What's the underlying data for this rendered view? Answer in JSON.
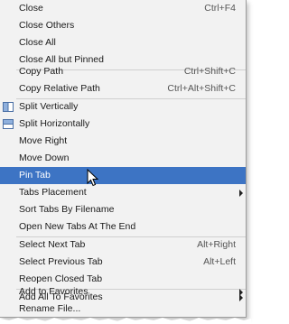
{
  "menu": {
    "items": [
      {
        "label": "Close",
        "shortcut": "Ctrl+F4"
      },
      {
        "label": "Close Others",
        "shortcut": ""
      },
      {
        "label": "Close All",
        "shortcut": ""
      },
      {
        "label": "Close All but Pinned",
        "shortcut": ""
      },
      {
        "label": "Copy Path",
        "shortcut": "Ctrl+Shift+C"
      },
      {
        "label": "Copy Relative Path",
        "shortcut": "Ctrl+Alt+Shift+C"
      },
      {
        "label": "Split Vertically",
        "shortcut": "",
        "icon": "split-vertical-icon"
      },
      {
        "label": "Split Horizontally",
        "shortcut": "",
        "icon": "split-horizontal-icon"
      },
      {
        "label": "Move Right",
        "shortcut": ""
      },
      {
        "label": "Move Down",
        "shortcut": ""
      },
      {
        "label": "Pin Tab",
        "shortcut": "",
        "selected": true
      },
      {
        "label": "Tabs Placement",
        "shortcut": "",
        "submenu": true
      },
      {
        "label": "Sort Tabs By Filename",
        "shortcut": ""
      },
      {
        "label": "Open New Tabs At The End",
        "shortcut": ""
      },
      {
        "label": "Select Next Tab",
        "shortcut": "Alt+Right"
      },
      {
        "label": "Select Previous Tab",
        "shortcut": "Alt+Left"
      },
      {
        "label": "Reopen Closed Tab",
        "shortcut": ""
      },
      {
        "label": "Add to Favorites",
        "shortcut": "",
        "submenu": true
      },
      {
        "label": "Add All To Favorites",
        "shortcut": "",
        "submenu": true
      },
      {
        "label": "Rename File...",
        "shortcut": ""
      }
    ]
  },
  "colors": {
    "menu_background": "#f2f2f2",
    "selection": "#3d74c4",
    "separator": "#cfcfcf"
  }
}
